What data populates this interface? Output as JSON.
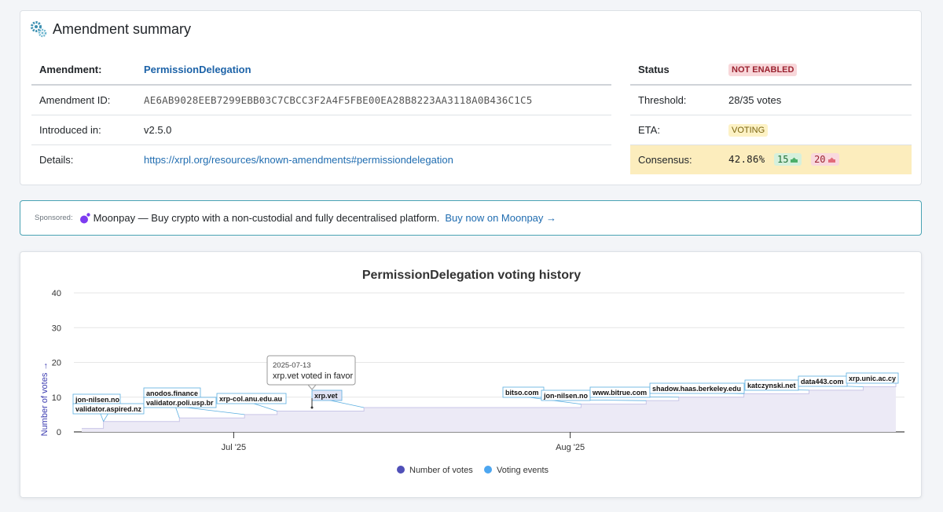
{
  "summary": {
    "title": "Amendment summary",
    "rows_left": [
      {
        "key": "Amendment:",
        "value": "PermissionDelegation"
      },
      {
        "key": "Amendment ID:",
        "value": "AE6AB9028EEB7299EBB03C7CBCC3F2A4F5FBE00EA28B8223AA3118A0B436C1C5"
      },
      {
        "key": "Introduced in:",
        "value": "v2.5.0"
      },
      {
        "key": "Details:",
        "value": "https://xrpl.org/resources/known-amendments#permissiondelegation"
      }
    ],
    "rows_right": {
      "status": {
        "key": "Status",
        "value": "NOT ENABLED"
      },
      "threshold": {
        "key": "Threshold:",
        "value": "28/35 votes"
      },
      "eta": {
        "key": "ETA:",
        "value": "VOTING"
      },
      "consensus": {
        "key": "Consensus:",
        "percent": "42.86%",
        "yes": "15",
        "no": "20"
      }
    },
    "colors": {
      "status_bad": "#f8d7da",
      "consensus_bg": "#fcedbd",
      "link": "#1f6cb0"
    }
  },
  "sponsor": {
    "label": "Sponsored:",
    "text": "Moonpay — Buy crypto with a non-custodial and fully decentralised platform.",
    "link": "Buy now on Moonpay →"
  },
  "chart_data": {
    "type": "area",
    "title": "PermissionDelegation voting history",
    "ylabel": "Number of votes →",
    "xlabel": "",
    "ylim": [
      0,
      40
    ],
    "yticks": [
      0,
      10,
      20,
      30,
      40
    ],
    "xticks": [
      "Jul '25",
      "Aug '25"
    ],
    "x_range": [
      "2025-06-17",
      "2025-08-31"
    ],
    "series": [
      {
        "name": "Number of votes",
        "color": "#5050b8",
        "points": [
          {
            "date": "2025-06-17",
            "votes": 1
          },
          {
            "date": "2025-06-19",
            "votes": 3
          },
          {
            "date": "2025-06-26",
            "votes": 4
          },
          {
            "date": "2025-07-02",
            "votes": 5
          },
          {
            "date": "2025-07-05",
            "votes": 6
          },
          {
            "date": "2025-07-13",
            "votes": 7
          },
          {
            "date": "2025-07-31",
            "votes": 7
          },
          {
            "date": "2025-08-02",
            "votes": 8
          },
          {
            "date": "2025-08-08",
            "votes": 9
          },
          {
            "date": "2025-08-11",
            "votes": 10
          },
          {
            "date": "2025-08-17",
            "votes": 11
          },
          {
            "date": "2025-08-23",
            "votes": 12
          },
          {
            "date": "2025-08-28",
            "votes": 13
          },
          {
            "date": "2025-08-31",
            "votes": 15
          }
        ]
      },
      {
        "name": "Voting events",
        "color": "#4da6f0",
        "events": [
          {
            "date": "2025-06-19",
            "label": "jon-nilsen.no"
          },
          {
            "date": "2025-06-19",
            "label": "validator.aspired.nz"
          },
          {
            "date": "2025-06-26",
            "label": "anodos.finance"
          },
          {
            "date": "2025-07-02",
            "label": "validator.poli.usp.br"
          },
          {
            "date": "2025-07-05",
            "label": "xrp-col.anu.edu.au"
          },
          {
            "date": "2025-07-13",
            "label": "xrp.vet"
          },
          {
            "date": "2025-08-02",
            "label": "bitso.com"
          },
          {
            "date": "2025-08-08",
            "label": "jon-nilsen.no"
          },
          {
            "date": "2025-08-11",
            "label": "www.bitrue.com"
          },
          {
            "date": "2025-08-17",
            "label": "shadow.haas.berkeley.edu"
          },
          {
            "date": "2025-08-23",
            "label": "katczynski.net"
          },
          {
            "date": "2025-08-28",
            "label": "data443.com"
          },
          {
            "date": "2025-08-31",
            "label": "xrp.unic.ac.cy"
          }
        ]
      }
    ],
    "tooltip": {
      "date": "2025-07-13",
      "text": "xrp.vet voted in favor"
    },
    "legend": "bottom-center",
    "grid": true
  }
}
